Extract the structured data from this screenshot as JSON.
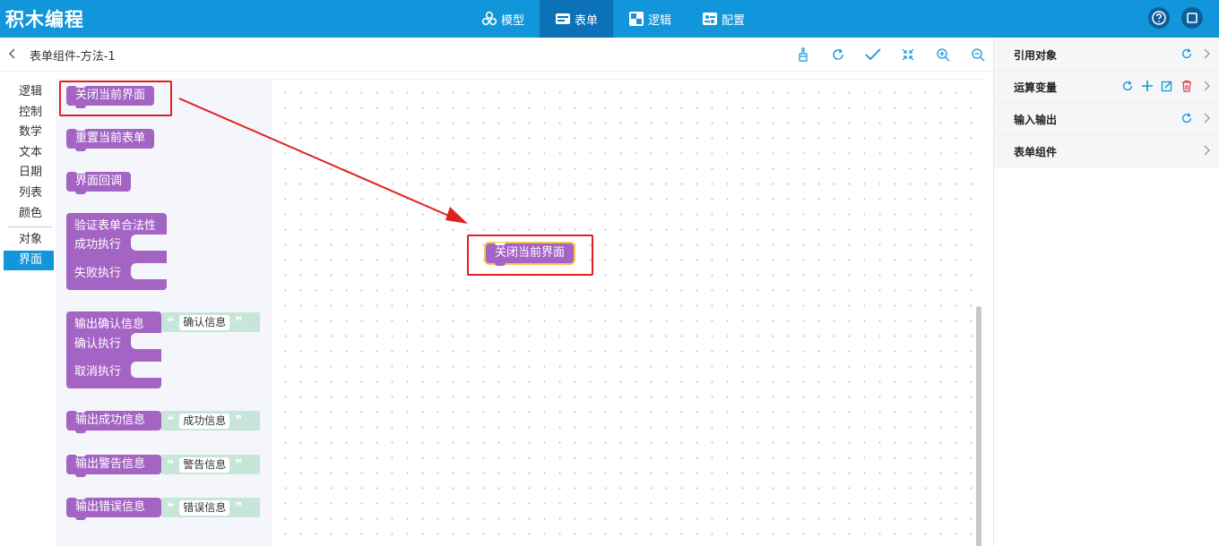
{
  "app": {
    "title": "积木编程"
  },
  "nav": [
    {
      "label": "模型",
      "icon": "model-icon",
      "active": false
    },
    {
      "label": "表单",
      "icon": "form-icon",
      "active": true
    },
    {
      "label": "逻辑",
      "icon": "logic-icon",
      "active": false
    },
    {
      "label": "配置",
      "icon": "config-icon",
      "active": false
    }
  ],
  "header": {
    "page_title": "表单组件-方法-1"
  },
  "categories": [
    "逻辑",
    "控制",
    "数学",
    "文本",
    "日期",
    "列表",
    "颜色",
    "对象",
    "界面"
  ],
  "active_category": "界面",
  "blocks": {
    "close_page": "关闭当前界面",
    "reset_form": "重置当前表单",
    "page_callback": "界面回调",
    "validate_form": "验证表单合法性",
    "on_success": "成功执行",
    "on_fail": "失败执行",
    "output_confirm": "输出确认信息",
    "confirm_text": "确认信息",
    "on_confirm": "确认执行",
    "on_cancel": "取消执行",
    "output_success": "输出成功信息",
    "success_text": "成功信息",
    "output_warning": "输出警告信息",
    "warning_text": "警告信息",
    "output_error": "输出错误信息",
    "error_text": "错误信息",
    "quote_open": "❝",
    "quote_close": "❞"
  },
  "canvas": {
    "placed_block": "关闭当前界面"
  },
  "right_panel": {
    "rows": [
      {
        "label": "引用对象"
      },
      {
        "label": "运算变量"
      },
      {
        "label": "输入输出"
      },
      {
        "label": "表单组件"
      }
    ]
  },
  "colors": {
    "topbar": "#1296db",
    "block": "#a464c4",
    "string": "#c7e5d9",
    "highlight": "#e02020"
  }
}
